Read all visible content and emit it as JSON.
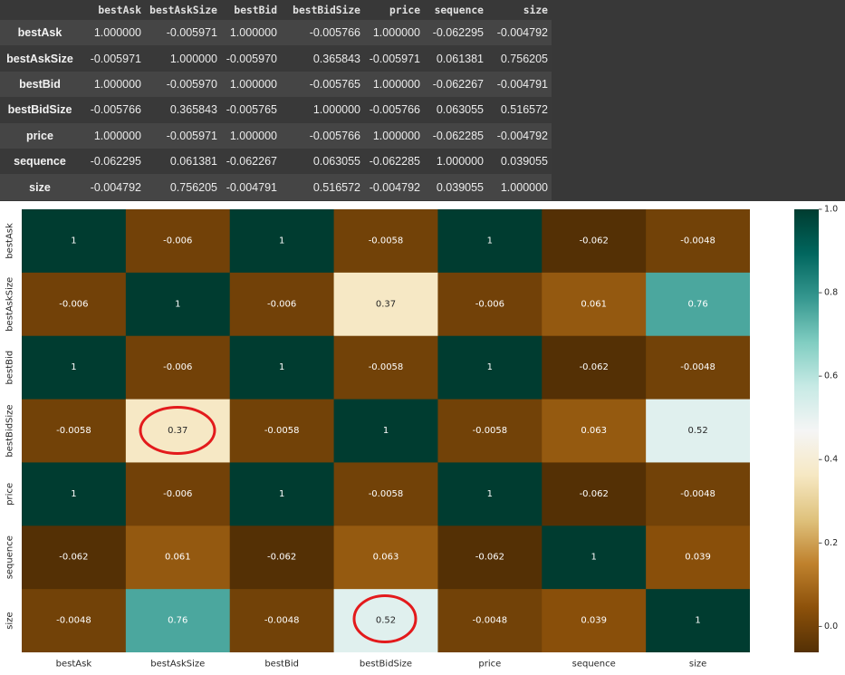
{
  "table": {
    "columns": [
      "bestAsk",
      "bestAskSize",
      "bestBid",
      "bestBidSize",
      "price",
      "sequence",
      "size"
    ],
    "rows": [
      {
        "label": "bestAsk",
        "cells": [
          "1.000000",
          "-0.005971",
          "1.000000",
          "-0.005766",
          "1.000000",
          "-0.062295",
          "-0.004792"
        ]
      },
      {
        "label": "bestAskSize",
        "cells": [
          "-0.005971",
          "1.000000",
          "-0.005970",
          "0.365843",
          "-0.005971",
          "0.061381",
          "0.756205"
        ]
      },
      {
        "label": "bestBid",
        "cells": [
          "1.000000",
          "-0.005970",
          "1.000000",
          "-0.005765",
          "1.000000",
          "-0.062267",
          "-0.004791"
        ]
      },
      {
        "label": "bestBidSize",
        "cells": [
          "-0.005766",
          "0.365843",
          "-0.005765",
          "1.000000",
          "-0.005766",
          "0.063055",
          "0.516572"
        ]
      },
      {
        "label": "price",
        "cells": [
          "1.000000",
          "-0.005971",
          "1.000000",
          "-0.005766",
          "1.000000",
          "-0.062285",
          "-0.004792"
        ]
      },
      {
        "label": "sequence",
        "cells": [
          "-0.062295",
          "0.061381",
          "-0.062267",
          "0.063055",
          "-0.062285",
          "1.000000",
          "0.039055"
        ]
      },
      {
        "label": "size",
        "cells": [
          "-0.004792",
          "0.756205",
          "-0.004791",
          "0.516572",
          "-0.004792",
          "0.039055",
          "1.000000"
        ]
      }
    ]
  },
  "chart_data": {
    "type": "heatmap",
    "x": [
      "bestAsk",
      "bestAskSize",
      "bestBid",
      "bestBidSize",
      "price",
      "sequence",
      "size"
    ],
    "y": [
      "bestAsk",
      "bestAskSize",
      "bestBid",
      "bestBidSize",
      "price",
      "sequence",
      "size"
    ],
    "values": [
      [
        1.0,
        -0.005971,
        1.0,
        -0.005766,
        1.0,
        -0.062295,
        -0.004792
      ],
      [
        -0.005971,
        1.0,
        -0.00597,
        0.365843,
        -0.005971,
        0.061381,
        0.756205
      ],
      [
        1.0,
        -0.00597,
        1.0,
        -0.005765,
        1.0,
        -0.062267,
        -0.004791
      ],
      [
        -0.005766,
        0.365843,
        -0.005765,
        1.0,
        -0.005766,
        0.063055,
        0.516572
      ],
      [
        1.0,
        -0.005971,
        1.0,
        -0.005766,
        1.0,
        -0.062285,
        -0.004792
      ],
      [
        -0.062295,
        0.061381,
        -0.062267,
        0.063055,
        -0.062285,
        1.0,
        0.039055
      ],
      [
        -0.004792,
        0.756205,
        -0.004791,
        0.516572,
        -0.004792,
        0.039055,
        1.0
      ]
    ],
    "annotations": [
      [
        "1",
        "-0.006",
        "1",
        "-0.0058",
        "1",
        "-0.062",
        "-0.0048"
      ],
      [
        "-0.006",
        "1",
        "-0.006",
        "0.37",
        "-0.006",
        "0.061",
        "0.76"
      ],
      [
        "1",
        "-0.006",
        "1",
        "-0.0058",
        "1",
        "-0.062",
        "-0.0048"
      ],
      [
        "-0.0058",
        "0.37",
        "-0.0058",
        "1",
        "-0.0058",
        "0.063",
        "0.52"
      ],
      [
        "1",
        "-0.006",
        "1",
        "-0.0058",
        "1",
        "-0.062",
        "-0.0048"
      ],
      [
        "-0.062",
        "0.061",
        "-0.062",
        "0.063",
        "-0.062",
        "1",
        "0.039"
      ],
      [
        "-0.0048",
        "0.76",
        "-0.0048",
        "0.52",
        "-0.0048",
        "0.039",
        "1"
      ]
    ],
    "vmin": -0.062295,
    "vmax": 1.0,
    "colormap_stops": [
      "#543005",
      "#8c510a",
      "#bf812d",
      "#dfc27d",
      "#f6e8c3",
      "#f5f5f5",
      "#c7eae5",
      "#80cdc1",
      "#35978f",
      "#01665e",
      "#003c30"
    ],
    "colorbar_ticks": [
      0.0,
      0.2,
      0.4,
      0.6,
      0.8,
      1.0
    ],
    "colorbar_tick_labels": [
      "0.0",
      "0.2",
      "0.4",
      "0.6",
      "0.8",
      "1.0"
    ],
    "colorbar_position": "right",
    "grid": false
  },
  "colors": {
    "annotation_dark": "#262626",
    "annotation_light": "#ffffff",
    "axis_text": "#262626",
    "highlight": "#e31a1c"
  }
}
